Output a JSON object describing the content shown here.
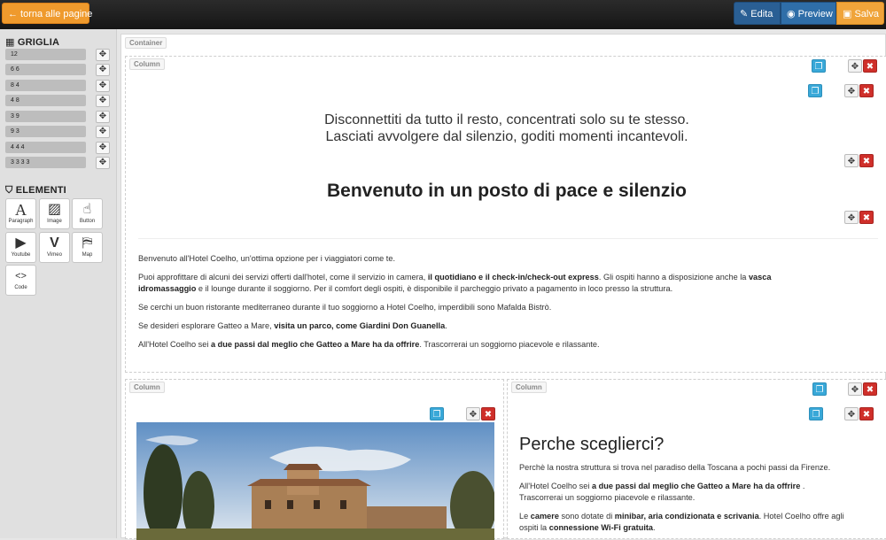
{
  "topbar": {
    "back_label": "← torna alle pagine",
    "edit_label": "Edita",
    "preview_label": "Preview",
    "save_label": "Salva"
  },
  "sidebar": {
    "grid_title": "GRIGLIA",
    "grid_rows": [
      "12",
      "6 6",
      "8 4",
      "4 8",
      "3 9",
      "9 3",
      "4 4 4",
      "3 3 3 3"
    ],
    "elements_title": "ELEMENTI",
    "elements": [
      "Paragraph",
      "Image",
      "Button",
      "Youtube",
      "Vimeo",
      "Map",
      "Code"
    ]
  },
  "canvas": {
    "container_tag": "Container",
    "column_tag": "Column",
    "heading1_line1": "Disconnettiti da tutto il resto, concentrati solo su te stesso.",
    "heading1_line2": "Lasciati avvolgere dal silenzio, goditi momenti incantevoli.",
    "heading2": "Benvenuto in un posto di pace e silenzio",
    "p1": "Benvenuto all'Hotel Coelho, un'ottima opzione per i viaggiatori come te.",
    "p2a": "Puoi approfittare di alcuni dei servizi offerti dall'hotel, come il servizio in camera, ",
    "p2b": "il quotidiano e il check-in/check-out express",
    "p2c": ". Gli ospiti hanno a disposizione anche la ",
    "p2d": "vasca",
    "p2e": "idromassaggio",
    "p2f": " e il lounge durante il soggiorno. Per il comfort degli ospiti, è disponibile il parcheggio privato a pagamento in loco presso la struttura.",
    "p3": "Se cerchi un buon ristorante mediterraneo durante il tuo soggiorno a Hotel Coelho, imperdibili sono Mafalda Bistrò.",
    "p4a": "Se desideri esplorare Gatteo a Mare, ",
    "p4b": "visita un parco, come Giardini Don Guanella",
    "p4c": ".",
    "p5a": "All'Hotel Coelho sei ",
    "p5b": "a due passi dal meglio che Gatteo a Mare ha da offrire",
    "p5c": ". Trascorrerai un soggiorno piacevole e rilassante.",
    "why_title": "Perche sceglierci?",
    "why_p1": "Perchè la nostra struttura si trova nel paradiso della Toscana a pochi passi da Firenze.",
    "why_p2a": "All'Hotel Coelho sei ",
    "why_p2b": "a due passi dal meglio che Gatteo a Mare ha da offrire",
    "why_p2c": " .",
    "why_p2d": "Trascorrerai un soggiorno piacevole e rilassante.",
    "why_p3a": "Le ",
    "why_p3b": "camere",
    "why_p3c": " sono dotate di ",
    "why_p3d": "minibar, aria condizionata e scrivania",
    "why_p3e": ". Hotel Coelho offre agli",
    "why_p3f": "ospiti la ",
    "why_p3g": "connessione Wi-Fi gratuita",
    "why_p3h": "."
  },
  "colors": {
    "accent_orange": "#ef9a2d",
    "edit_blue": "#2a5f94",
    "delete_red": "#cf2f2a",
    "copy_blue": "#39a8d8"
  }
}
